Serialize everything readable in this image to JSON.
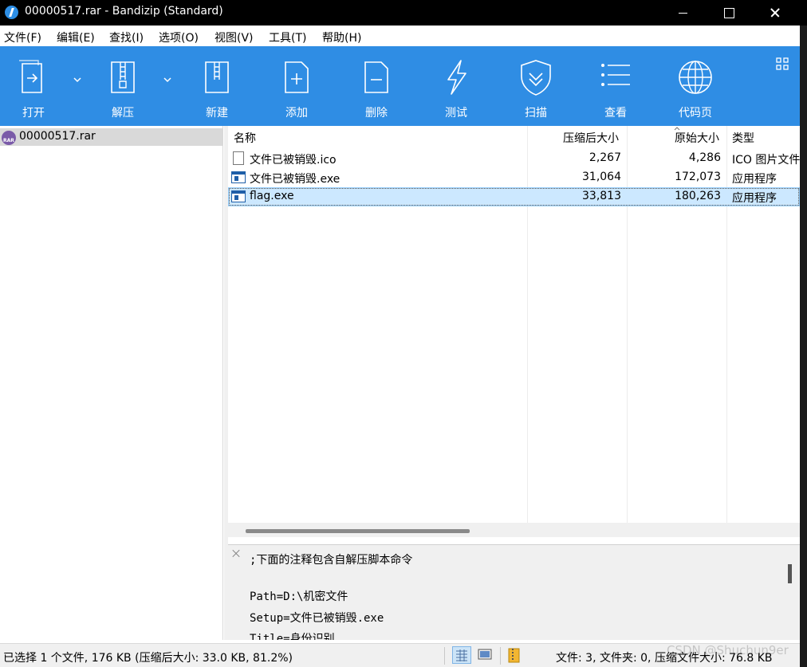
{
  "window": {
    "title": "00000517.rar - Bandizip (Standard)"
  },
  "menu": [
    "文件(F)",
    "编辑(E)",
    "查找(I)",
    "选项(O)",
    "视图(V)",
    "工具(T)",
    "帮助(H)"
  ],
  "toolbar": {
    "open": "打开",
    "extract": "解压",
    "new": "新建",
    "add": "添加",
    "delete": "删除",
    "test": "测试",
    "scan": "扫描",
    "view": "查看",
    "codepage": "代码页"
  },
  "tree": {
    "archive_name": "00000517.rar",
    "rar_badge": "RAR"
  },
  "filelist": {
    "columns": {
      "name": "名称",
      "packed": "压缩后大小",
      "original": "原始大小",
      "type": "类型"
    },
    "rows": [
      {
        "name": "文件已被销毁.ico",
        "packed": "2,267",
        "original": "4,286",
        "type": "ICO 图片文件",
        "icon": "ico-file-icon"
      },
      {
        "name": "文件已被销毁.exe",
        "packed": "31,064",
        "original": "172,073",
        "type": "应用程序",
        "icon": "exe-file-icon"
      },
      {
        "name": "flag.exe",
        "packed": "33,813",
        "original": "180,263",
        "type": "应用程序",
        "icon": "exe-file-icon",
        "selected": true
      }
    ]
  },
  "comment": {
    "lines": [
      ";下面的注释包含自解压脚本命令",
      "",
      "Path=D:\\机密文件",
      "Setup=文件已被销毁.exe",
      "Title=身份识别"
    ]
  },
  "status": {
    "selection": "已选择 1 个文件, 176 KB (压缩后大小: 33.0 KB, 81.2%)",
    "summary": "文件: 3, 文件夹: 0, 压缩文件大小: 76.8 KB"
  },
  "watermark": "CSDN @Shuchun9er",
  "colors": {
    "toolbar": "#2f8de4",
    "selection": "#cce8ff",
    "titlebar": "#000000"
  }
}
